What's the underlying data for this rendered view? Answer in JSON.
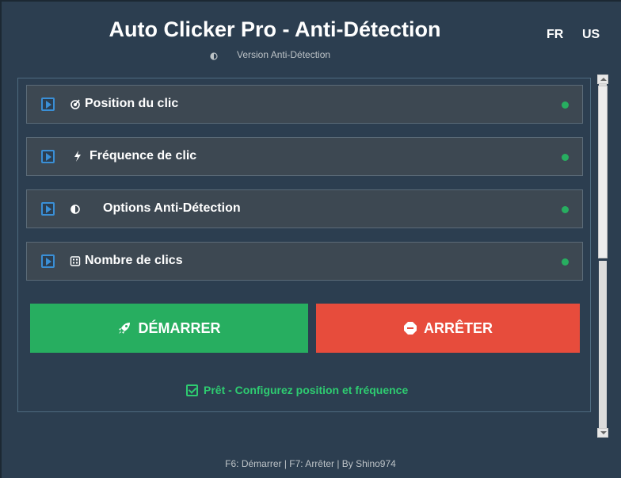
{
  "header": {
    "title": "Auto Clicker Pro - Anti-Détection",
    "subtitle": "Version Anti-Détection",
    "languages": [
      "FR",
      "US"
    ]
  },
  "sections": [
    {
      "label": "Position du clic",
      "icon": "target-icon",
      "status_color": "#27ae60"
    },
    {
      "label": "Fréquence de clic",
      "icon": "lightning-icon",
      "status_color": "#27ae60"
    },
    {
      "label": "Options Anti-Détection",
      "icon": "half-circle-icon",
      "status_color": "#27ae60"
    },
    {
      "label": "Nombre de clics",
      "icon": "counter-icon",
      "status_color": "#27ae60"
    }
  ],
  "buttons": {
    "start_label": "DÉMARRER",
    "stop_label": "ARRÊTER",
    "start_color": "#27ae60",
    "stop_color": "#e74c3c"
  },
  "status": {
    "text": "Prêt - Configurez position et fréquence",
    "color": "#2ecc71"
  },
  "footer": {
    "text": "F6: Démarrer | F7: Arrêter | By Shino974"
  }
}
